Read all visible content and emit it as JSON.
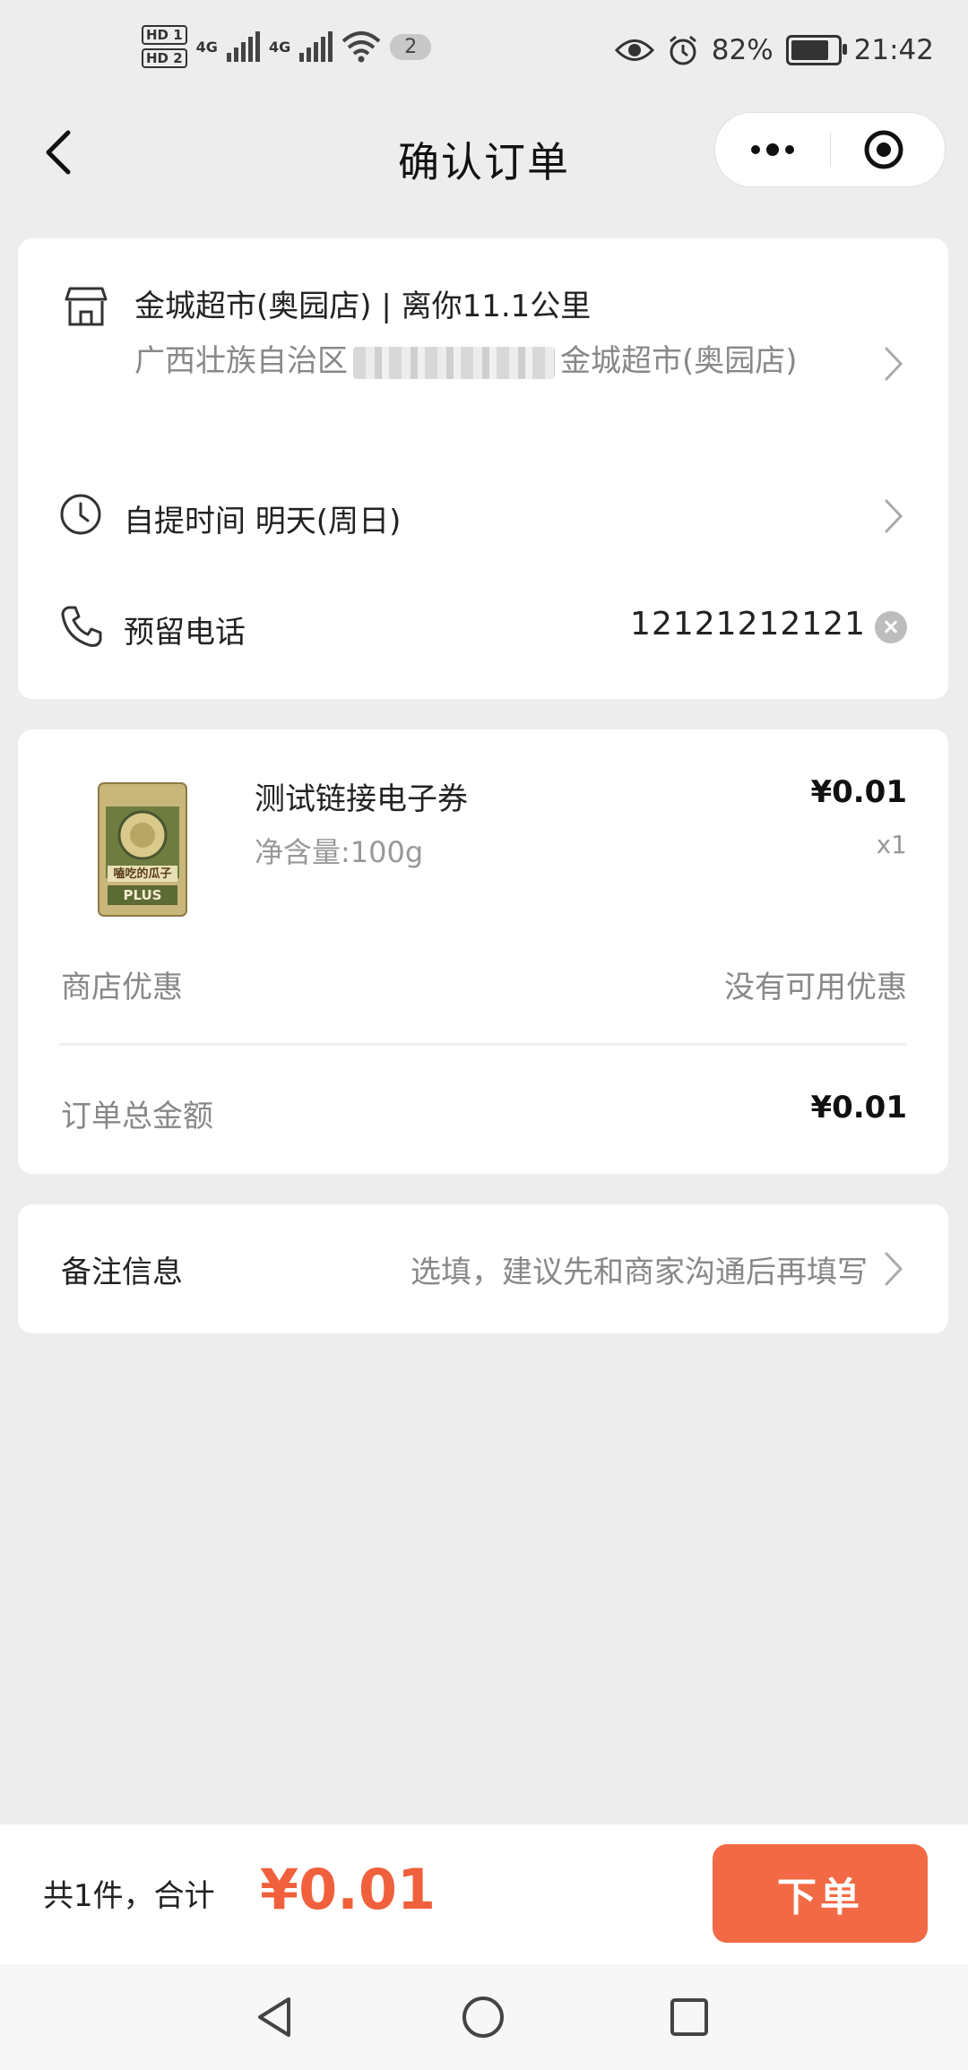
{
  "status_bar": {
    "sim1": "HD 1",
    "sim2": "HD 2",
    "network1": "4G",
    "network2": "4G",
    "notification_count": "2",
    "battery_percent": "82%",
    "battery_level": 0.82,
    "time": "21:42"
  },
  "header": {
    "title": "确认订单"
  },
  "store": {
    "name_distance": "金城超市(奥园店) | 离你11.1公里",
    "address_prefix": "广西壮族自治区",
    "address_suffix": "金城超市(奥园店)"
  },
  "pickup": {
    "label_value": "自提时间 明天(周日)"
  },
  "phone": {
    "label": "预留电话",
    "value": "12121212121"
  },
  "product": {
    "name": "测试链接电子券",
    "spec": "净含量:100g",
    "price": "¥0.01",
    "qty": "x1",
    "image_text_top": "嗑吃的瓜子",
    "image_text_bottom": "PLUS"
  },
  "promo": {
    "label": "商店优惠",
    "value": "没有可用优惠"
  },
  "order_total": {
    "label": "订单总金额",
    "value": "¥0.01"
  },
  "note": {
    "label": "备注信息",
    "placeholder": "选填，建议先和商家沟通后再填写"
  },
  "footer": {
    "summary": "共1件，合计",
    "total": "¥0.01",
    "submit_label": "下单"
  },
  "colors": {
    "accent": "#f26a45",
    "price_accent": "#f0603c",
    "background": "#ededed"
  }
}
